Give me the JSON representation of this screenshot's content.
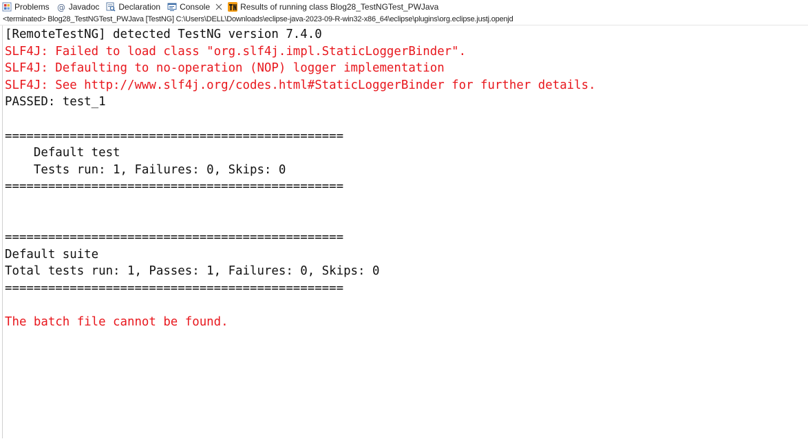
{
  "tabs": [
    {
      "label": "Problems",
      "icon": "problems-icon",
      "active": false
    },
    {
      "label": "Javadoc",
      "icon": "javadoc-icon",
      "active": false
    },
    {
      "label": "Declaration",
      "icon": "declaration-icon",
      "active": false
    },
    {
      "label": "Console",
      "icon": "console-icon",
      "active": true
    },
    {
      "label": "Results of running class Blog28_TestNGTest_PWJava",
      "icon": "testng-icon",
      "active": false
    }
  ],
  "status_line": "<terminated> Blog28_TestNGTest_PWJava [TestNG] C:\\Users\\DELL\\Downloads\\eclipse-java-2023-09-R-win32-x86_64\\eclipse\\plugins\\org.eclipse.justj.openjd",
  "console_lines": [
    {
      "text": "[RemoteTestNG] detected TestNG version 7.4.0",
      "err": false
    },
    {
      "text": "SLF4J: Failed to load class \"org.slf4j.impl.StaticLoggerBinder\".",
      "err": true
    },
    {
      "text": "SLF4J: Defaulting to no-operation (NOP) logger implementation",
      "err": true
    },
    {
      "text": "SLF4J: See http://www.slf4j.org/codes.html#StaticLoggerBinder for further details.",
      "err": true
    },
    {
      "text": "PASSED: test_1",
      "err": false
    },
    {
      "text": "",
      "err": false
    },
    {
      "text": "===============================================",
      "err": false
    },
    {
      "text": "    Default test",
      "err": false
    },
    {
      "text": "    Tests run: 1, Failures: 0, Skips: 0",
      "err": false
    },
    {
      "text": "===============================================",
      "err": false
    },
    {
      "text": "",
      "err": false
    },
    {
      "text": "",
      "err": false
    },
    {
      "text": "===============================================",
      "err": false
    },
    {
      "text": "Default suite",
      "err": false
    },
    {
      "text": "Total tests run: 1, Passes: 1, Failures: 0, Skips: 0",
      "err": false
    },
    {
      "text": "===============================================",
      "err": false
    },
    {
      "text": "",
      "err": false
    },
    {
      "text": "The batch file cannot be found.",
      "err": true
    }
  ],
  "colors": {
    "error_text": "#e8171d",
    "normal_text": "#111111"
  }
}
